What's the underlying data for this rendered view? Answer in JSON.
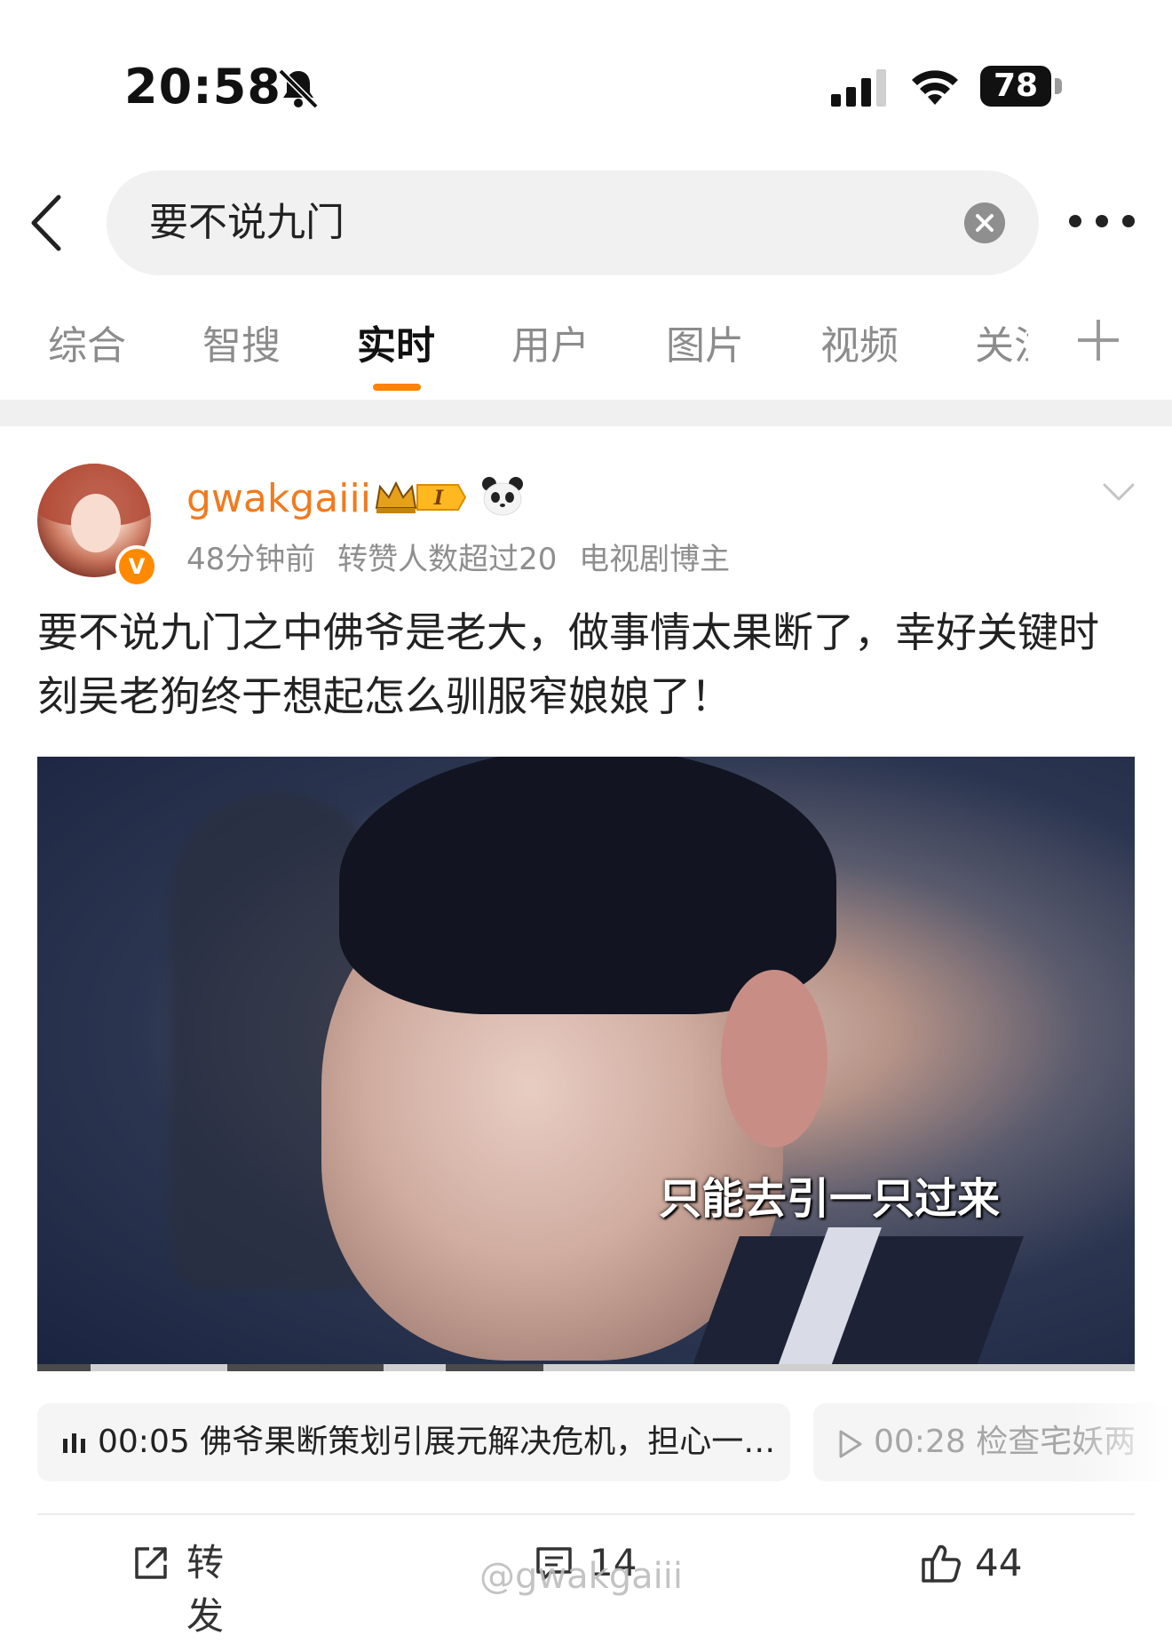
{
  "status_bar": {
    "time": "20:58",
    "battery": "78"
  },
  "search": {
    "query": "要不说九门"
  },
  "tabs": [
    {
      "label": "综合",
      "active": false
    },
    {
      "label": "智搜",
      "active": false
    },
    {
      "label": "实时",
      "active": true
    },
    {
      "label": "用户",
      "active": false
    },
    {
      "label": "图片",
      "active": false
    },
    {
      "label": "视频",
      "active": false
    },
    {
      "label": "关注",
      "active": false
    }
  ],
  "accent_color": "#ff8200",
  "post": {
    "username": "gwakgaiii",
    "level_badge": "I",
    "meta": {
      "time": "48分钟前",
      "stat": "转赞人数超过20",
      "tag": "电视剧博主"
    },
    "text": "要不说九门之中佛爷是老大，做事情太果断了，幸好关键时刻吴老狗终于想起怎么驯服窄娘娘了！",
    "video": {
      "subtitle": "只能去引一只过来"
    },
    "chapters": [
      {
        "time": "00:05",
        "title": "佛爷果断策划引展元解决危机，担心一…"
      },
      {
        "time": "00:28",
        "title": "检查宅妖两"
      }
    ],
    "actions": {
      "repost": "转发",
      "comments": "14",
      "likes": "44"
    },
    "watermark": "@gwakgaiii"
  }
}
